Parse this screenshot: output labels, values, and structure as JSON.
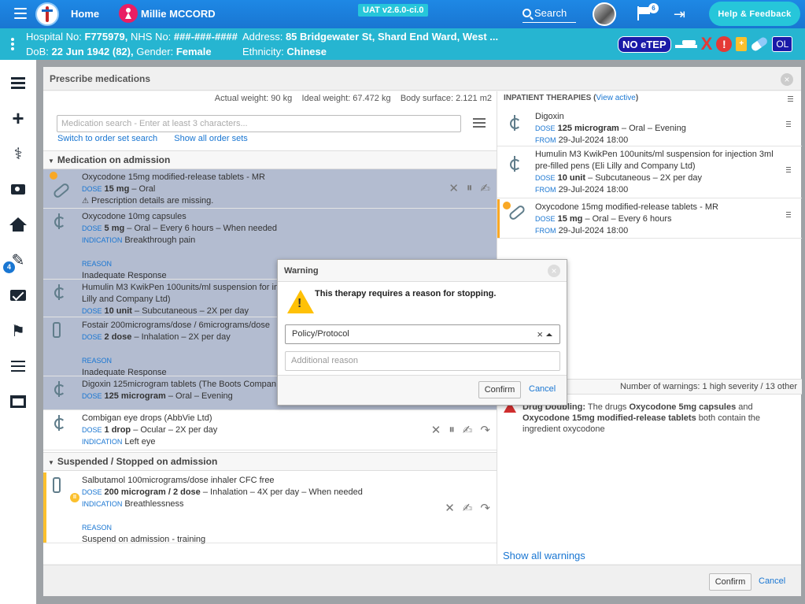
{
  "topbar": {
    "home": "Home",
    "patient_name": "Millie MCCORD",
    "env": "UAT v2.6.0-ci.0",
    "search": "Search",
    "flag_count": "6",
    "help": "Help & Feedback"
  },
  "banner": {
    "hospital_label": "Hospital No:",
    "hospital_no": "F775979,",
    "nhs_label": "NHS No:",
    "nhs_no": "###-###-####",
    "dob_label": "DoB:",
    "dob": "22 Jun 1942 (82),",
    "gender_label": "Gender:",
    "gender": "Female",
    "address_label": "Address:",
    "address": "85 Bridgewater St, Shard End Ward, West ...",
    "ethnicity_label": "Ethnicity:",
    "ethnicity": "Chinese",
    "no_etep": "NO eTEP",
    "ol": "OL"
  },
  "nav": {
    "badge_count": "4"
  },
  "modal": {
    "title": "Prescribe medications",
    "actual_weight": "Actual weight: 90 kg",
    "ideal_weight": "Ideal weight: 67.472 kg",
    "body_surface": "Body surface: 2.121 m2",
    "search_placeholder": "Medication search - Enter at least 3 characters...",
    "switch_link": "Switch to order set search",
    "show_sets_link": "Show all order sets",
    "section_admission": "Medication on admission",
    "section_suspended": "Suspended / Stopped on admission",
    "confirm": "Confirm",
    "cancel": "Cancel"
  },
  "labels": {
    "dose": "DOSE",
    "indication": "INDICATION",
    "reason": "REASON",
    "from": "FROM"
  },
  "meds": [
    {
      "name": "Oxycodone 15mg modified-release tablets - MR",
      "dose": "15 mg",
      "route": "– Oral",
      "note": "Prescription details are missing."
    },
    {
      "name": "Oxycodone 10mg capsules",
      "dose": "5 mg",
      "route": "– Oral – Every 6 hours – When needed",
      "indication": "Breakthrough pain",
      "reason": "Inadequate Response"
    },
    {
      "name": "Humulin M3 KwikPen 100units/ml suspension for in",
      "name2": "Lilly and Company Ltd)",
      "dose": "10 unit",
      "route": "– Subcutaneous – 2X per day"
    },
    {
      "name": "Fostair 200micrograms/dose / 6micrograms/dose",
      "dose": "2 dose",
      "route": "– Inhalation – 2X per day",
      "reason": "Inadequate Response"
    },
    {
      "name": "Digoxin 125microgram tablets (The Boots Compan",
      "dose": "125 microgram",
      "route": "– Oral – Evening"
    },
    {
      "name": "Combigan eye drops (AbbVie Ltd)",
      "dose": "1 drop",
      "route": "– Ocular – 2X per day",
      "indication": "Left eye"
    }
  ],
  "suspended": {
    "name": "Salbutamol 100micrograms/dose inhaler CFC free",
    "dose": "200 microgram / 2 dose",
    "route": "– Inhalation – 4X per day – When needed",
    "indication": "Breathlessness",
    "reason": "Suspend on admission - training"
  },
  "inpatient": {
    "header": "INPATIENT THERAPIES",
    "view_active": "View active",
    "items": [
      {
        "name": "Digoxin",
        "dose": "125 microgram",
        "route": "– Oral – Evening",
        "from": "29-Jul-2024 18:00"
      },
      {
        "name": "Humulin M3 KwikPen 100units/ml suspension for injection 3ml",
        "name2": "pre-filled pens (Eli Lilly and Company Ltd)",
        "dose": "10 unit",
        "route": "– Subcutaneous – 2X per day",
        "from": "29-Jul-2024 18:00"
      },
      {
        "name": "Oxycodone 15mg modified-release tablets - MR",
        "dose": "15 mg",
        "route": "– Oral – Every 6 hours",
        "from": "29-Jul-2024 18:00"
      }
    ]
  },
  "warnings": {
    "summary": "Number of warnings: 1 high severity / 13 other",
    "item_title": "Drug Doubling:",
    "item_text1": "The drugs",
    "drug_a": "Oxycodone 5mg capsules",
    "item_and": "and",
    "drug_b": "Oxycodone 15mg modified-release tablets",
    "item_text2": "both contain the",
    "item_text3": "ingredient oxycodone",
    "show_all": "Show all warnings"
  },
  "dialog": {
    "title": "Warning",
    "message": "This therapy requires a reason for stopping.",
    "selected": "Policy/Protocol",
    "placeholder": "Additional reason",
    "confirm": "Confirm",
    "cancel": "Cancel"
  }
}
